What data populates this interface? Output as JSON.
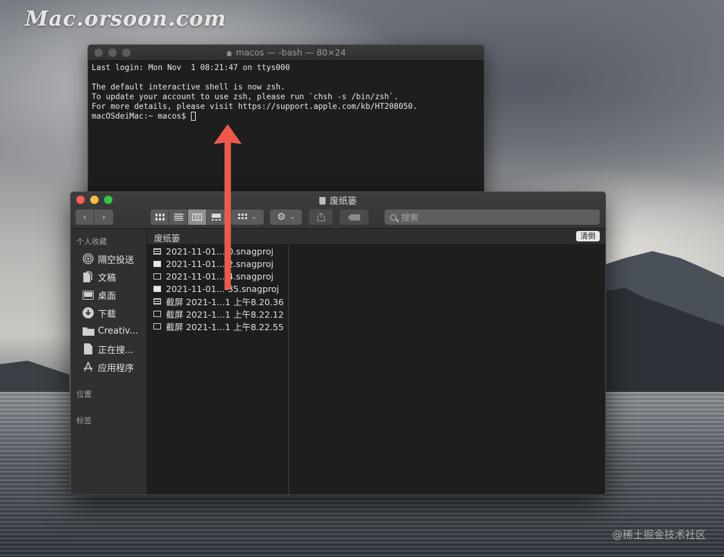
{
  "watermark": "Mac.orsoon.com",
  "credit": "@稀土掘金技术社区",
  "terminal": {
    "title": "macos — -bash — 80×24",
    "lines": [
      "Last login: Mon Nov  1 08:21:47 on ttys000",
      "",
      "The default interactive shell is now zsh.",
      "To update your account to use zsh, please run `chsh -s /bin/zsh`.",
      "For more details, please visit https://support.apple.com/kb/HT208050."
    ],
    "prompt": "macOSdeiMac:~ macos$ "
  },
  "finder": {
    "title": "废纸篓",
    "search_placeholder": "搜索",
    "path_label": "废纸篓",
    "empty_button": "清倒",
    "sidebar": {
      "favorites_header": "个人收藏",
      "items": [
        {
          "label": "隔空投送",
          "icon": "airdrop-icon"
        },
        {
          "label": "文稿",
          "icon": "documents-icon"
        },
        {
          "label": "桌面",
          "icon": "desktop-icon"
        },
        {
          "label": "下载",
          "icon": "downloads-icon"
        },
        {
          "label": "Creativ...",
          "icon": "folder-icon"
        },
        {
          "label": "正在搜...",
          "icon": "document-icon"
        },
        {
          "label": "应用程序",
          "icon": "applications-icon"
        }
      ],
      "locations_header": "位置",
      "tags_header": "标签"
    },
    "files": [
      {
        "name": "2021-11-01...-0.snagproj",
        "icon": "lined"
      },
      {
        "name": "2021-11-01...-2.snagproj",
        "icon": "filled"
      },
      {
        "name": "2021-11-01...-4.snagproj",
        "icon": "outline"
      },
      {
        "name": "2021-11-01...-35.snagproj",
        "icon": "filled"
      },
      {
        "name": "截屏 2021-1...1 上午8.20.36",
        "icon": "lined"
      },
      {
        "name": "截屏 2021-1...1 上午8.22.12",
        "icon": "outline"
      },
      {
        "name": "截屏 2021-1...1 上午8.22.55",
        "icon": "outline"
      }
    ]
  },
  "colors": {
    "arrow": "#f0564a",
    "close": "#fc605b",
    "minimize": "#fdbc40",
    "zoom": "#34c84a"
  }
}
